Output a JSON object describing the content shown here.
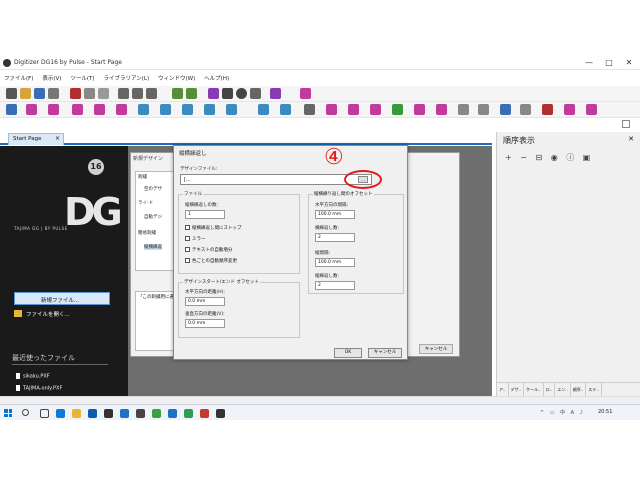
{
  "window": {
    "title": "Digitizer DG16 by Pulse - Start Page",
    "controls": [
      "—",
      "□",
      "✕"
    ]
  },
  "menu": [
    "ファイル(F)",
    "表示(V)",
    "ツール(T)",
    "ライブラリアン(L)",
    "ウィンドウ(W)",
    "ヘルプ(H)"
  ],
  "tabs": {
    "start_page": "Start Page",
    "close": "×"
  },
  "left_panel": {
    "logo_text": "DG",
    "logo_badge": "16",
    "tagline": "TAJIMA DG | BY PULSE",
    "new_file": "新規ファイル...",
    "open_file": "ファイルを開く...",
    "recent_title": "最近使ったファイル",
    "recent_files": [
      "sikaku.PXF",
      "TAJIMA-only.PXF"
    ]
  },
  "bg_dialog": {
    "title": "新規デザイン",
    "items": [
      "刺繍",
      "空のデザ",
      "ライ-ド",
      "自動デジ",
      "簡易刺繍",
      "縦横繰返"
    ],
    "description": "「この刺繍用に選",
    "cancel": "キャンセル"
  },
  "dialog": {
    "title": "縦横繰返し",
    "annotation_number": "④",
    "design_file_label": "デザインファイル:",
    "design_file_value": "[...",
    "browse": "...",
    "file_group": "ファイル",
    "repeat_count_label": "縦横繰返しの数:",
    "repeat_count_value": "1",
    "checkboxes": [
      "縦横繰返し間にストップ",
      "ミラー",
      "テキストの自動増分",
      "色ごとの自動順序変更"
    ],
    "startend_group": "デザインスタート/エンド オフセット",
    "h_dist_label": "水平方向の距離(H):",
    "h_dist_value": "0.0 mm",
    "v_dist_label": "垂直方向の距離(V):",
    "v_dist_value": "0.0 mm",
    "offset_group": "縦横繰り返し間のオフセット",
    "h_gap_label": "水平方向の間隔:",
    "h_gap_value": "100.0 mm",
    "h_count_label": "横繰返し数:",
    "h_count_value": "2",
    "v_gap_label": "縦間隔:",
    "v_gap_value": "100.0 mm",
    "v_count_label": "縦繰返し数:",
    "v_count_value": "2",
    "ok": "OK",
    "cancel": "キャンセル"
  },
  "right_panel": {
    "title": "順序表示",
    "close": "✕",
    "tools": "+ − ⊟ ◉ ⓘ ▣",
    "bottom_tabs": [
      "ア..",
      "デザ..",
      "ケール..",
      "ロ..",
      "エン..",
      "順序..",
      "ステ.."
    ]
  },
  "taskbar": {
    "time": "20:51",
    "tray": "^ ▭ 中 A ♪"
  },
  "colors": {
    "accent": "#1b6fc2",
    "annotation": "#e31b1b",
    "dark_panel": "#1a1a1a"
  }
}
